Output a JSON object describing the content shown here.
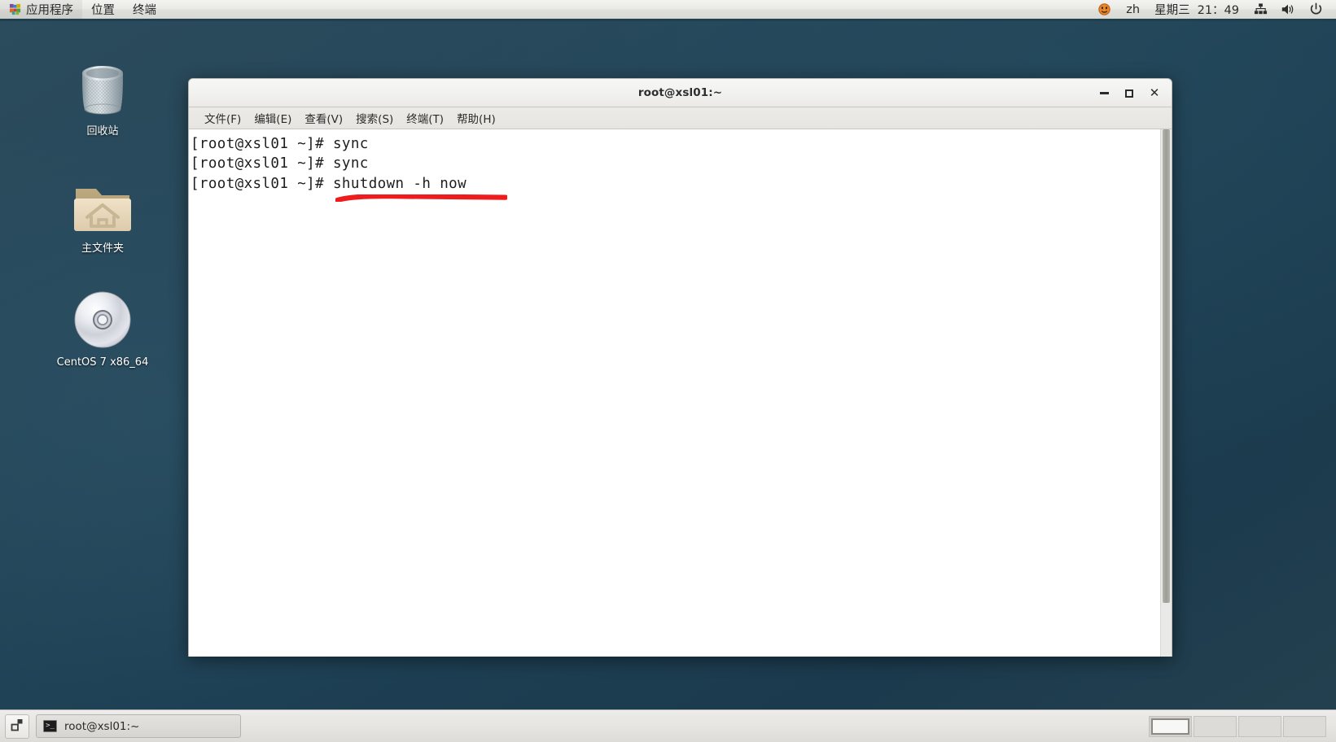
{
  "top_panel": {
    "logo_icon": "gnome-footprint-icon",
    "menus": [
      {
        "label": "应用程序",
        "name": "applications"
      },
      {
        "label": "位置",
        "name": "places"
      },
      {
        "label": "终端",
        "name": "terminal"
      }
    ],
    "tray": {
      "notification_icon": "orange-smiley-icon",
      "input_method": "zh",
      "day": "星期三",
      "time": "21：49",
      "network_icon": "network-icon",
      "volume_icon": "volume-icon",
      "power_icon": "power-icon"
    }
  },
  "desktop_icons": [
    {
      "label": "回收站",
      "icon": "trash-icon",
      "name": "desktop-icon-trash"
    },
    {
      "label": "主文件夹",
      "icon": "home-folder-icon",
      "name": "desktop-icon-home"
    },
    {
      "label": "CentOS 7 x86_64",
      "icon": "cd-disc-icon",
      "name": "desktop-icon-centos-disc"
    }
  ],
  "terminal_window": {
    "title": "root@xsl01:~",
    "window_buttons": {
      "minimize": "minimize-icon",
      "maximize": "maximize-icon",
      "close": "close-icon"
    },
    "menus": [
      {
        "label": "文件(F)",
        "name": "file"
      },
      {
        "label": "编辑(E)",
        "name": "edit"
      },
      {
        "label": "查看(V)",
        "name": "view"
      },
      {
        "label": "搜索(S)",
        "name": "search"
      },
      {
        "label": "终端(T)",
        "name": "terminal"
      },
      {
        "label": "帮助(H)",
        "name": "help"
      }
    ],
    "content": "[root@xsl01 ~]# sync\n[root@xsl01 ~]# sync\n[root@xsl01 ~]# shutdown -h now",
    "annotation": {
      "type": "red-underline",
      "color": "#ee1c1c",
      "underlines_text": "shutdown -h now"
    }
  },
  "taskbar": {
    "show_desktop_icon": "show-desktop-icon",
    "tasks": [
      {
        "label": "root@xsl01:~",
        "icon": "terminal-icon",
        "active": true
      }
    ],
    "workspaces": [
      {
        "name": "workspace-1",
        "active": true
      },
      {
        "name": "workspace-2",
        "active": false
      },
      {
        "name": "workspace-3",
        "active": false
      },
      {
        "name": "workspace-4",
        "active": false
      }
    ]
  },
  "colors": {
    "desktop_bg": "#1e4054",
    "panel_bg": "#ebebe8",
    "panel_border": "#20404f",
    "terminal_bg": "#ffffff",
    "annotation_red": "#ee1c1c"
  }
}
